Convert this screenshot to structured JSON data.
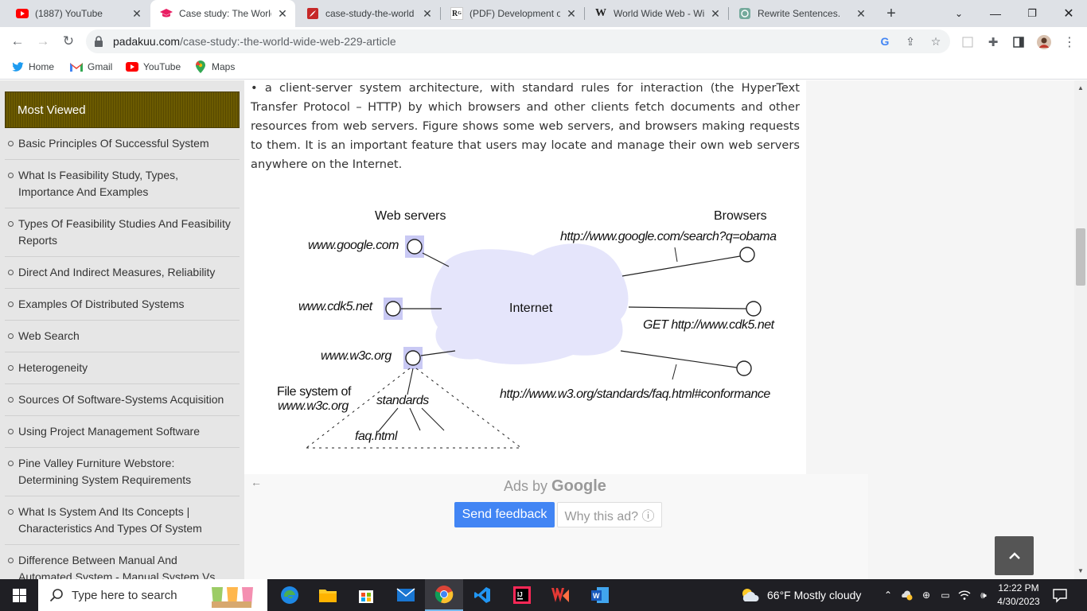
{
  "tabs": [
    {
      "title": "(1887) YouTube",
      "icon": "youtube-icon",
      "active": false
    },
    {
      "title": "Case study: The World",
      "icon": "graduation-cap-icon",
      "active": true
    },
    {
      "title": "case-study-the-world",
      "icon": "pdf-icon",
      "active": false
    },
    {
      "title": "(PDF) Development of",
      "icon": "researchgate-icon",
      "active": false
    },
    {
      "title": "World Wide Web - Wi",
      "icon": "wikipedia-icon",
      "active": false
    },
    {
      "title": "Rewrite Sentences.",
      "icon": "chatgpt-icon",
      "active": false
    }
  ],
  "address": {
    "host": "padakuu.com",
    "path": "/case-study:-the-world-wide-web-229-article"
  },
  "bookmarks": [
    {
      "label": "Home",
      "icon": "twitter-icon"
    },
    {
      "label": "Gmail",
      "icon": "gmail-icon"
    },
    {
      "label": "YouTube",
      "icon": "youtube-icon"
    },
    {
      "label": "Maps",
      "icon": "maps-icon"
    }
  ],
  "sidebar": {
    "title": "Most Viewed",
    "items": [
      "Basic Principles Of Successful System",
      "What Is Feasibility Study, Types, Importance And Examples",
      "Types Of Feasibility Studies And Feasibility Reports",
      "Direct And Indirect Measures, Reliability",
      "Examples Of Distributed Systems",
      "Web Search",
      "Heterogeneity",
      "Sources Of Software-Systems Acquisition",
      "Using Project Management Software",
      "Pine Valley Furniture Webstore: Determining System Requirements",
      "What Is System And Its Concepts | Characteristics And Types Of System",
      "Difference Between Manual And Automated System - Manual System Vs Automated System"
    ]
  },
  "article": {
    "paragraph": "• a client-server system architecture, with standard rules for interaction (the HyperText Transfer Protocol – HTTP) by which browsers and other clients fetch documents and other resources from web servers. Figure shows some web servers, and browsers making requests to them. It is an important feature that users may locate and manage their own web servers anywhere on the Internet."
  },
  "figure": {
    "web_servers_heading": "Web servers",
    "browsers_heading": "Browsers",
    "cloud_label": "Internet",
    "servers": [
      "www.google.com",
      "www.cdk5.net",
      "www.w3c.org"
    ],
    "requests": [
      "http://www.google.com/search?q=obama",
      "GET http://www.cdk5.net",
      "http://www.w3.org/standards/faq.html#conformance"
    ],
    "file_system_line1": "File system of",
    "file_system_line2": "www.w3c.org",
    "standards_label": "standards",
    "faq_label": "faq.html"
  },
  "ads": {
    "ads_by": "Ads by",
    "google": "Google",
    "send_feedback": "Send feedback",
    "why_this_ad": "Why this ad? ⓘ"
  },
  "taskbar": {
    "search_placeholder": "Type here to search",
    "weather": "66°F  Mostly cloudy",
    "time": "12:22 PM",
    "date": "4/30/2023"
  }
}
